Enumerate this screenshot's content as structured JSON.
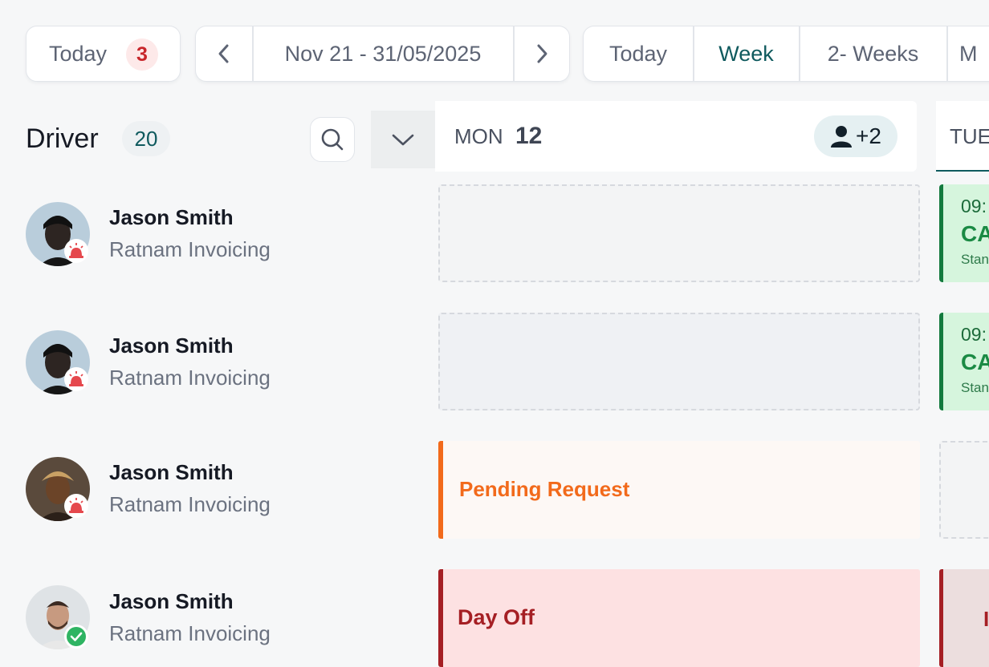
{
  "toolbar": {
    "today_label": "Today",
    "today_badge": "3",
    "date_range": "Nov 21 - 31/05/2025",
    "views": [
      "Today",
      "Week",
      "2- Weeks",
      "M"
    ],
    "active_view": "Week"
  },
  "sidebar": {
    "title": "Driver",
    "count": "20"
  },
  "days": {
    "mon_label": "MON",
    "mon_num": "12",
    "mon_extra": "+2",
    "tue_label": "TUE"
  },
  "drivers": [
    {
      "name": "Jason Smith",
      "company": "Ratnam Invoicing",
      "status": "alert"
    },
    {
      "name": "Jason Smith",
      "company": "Ratnam Invoicing",
      "status": "alert"
    },
    {
      "name": "Jason Smith",
      "company": "Ratnam Invoicing",
      "status": "alert"
    },
    {
      "name": "Jason Smith",
      "company": "Ratnam Invoicing",
      "status": "ok"
    }
  ],
  "cells": {
    "pending": "Pending Request",
    "day_off": "Day Off",
    "shift1_time": "09:",
    "shift1_code": "CA",
    "shift1_sub": "Stan",
    "shift2_time": "09:",
    "shift2_code": "CA",
    "shift2_sub": "Stan",
    "tue_dayoff_glyph": "I"
  },
  "colors": {
    "accent_teal": "#0f5a5e",
    "pending_orange": "#f26a1b",
    "dayoff_red": "#a51f24",
    "shift_green": "#137a3e"
  }
}
